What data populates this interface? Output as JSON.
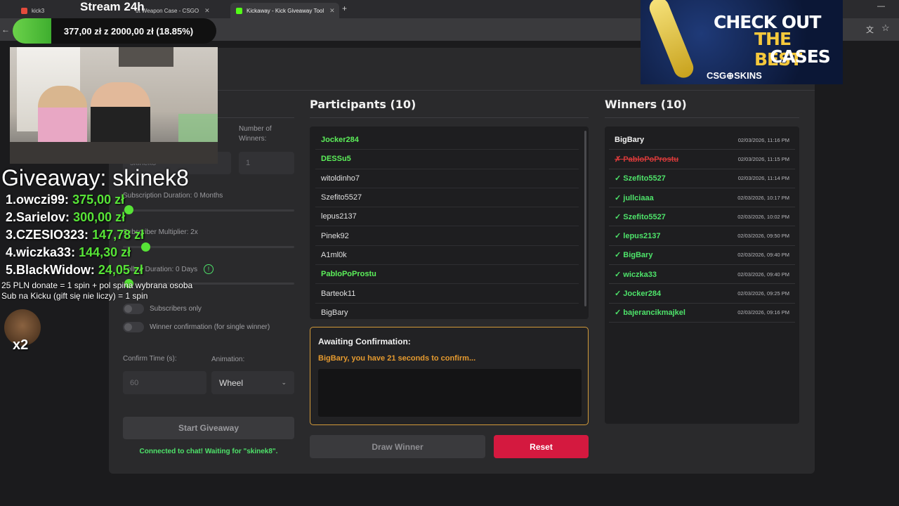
{
  "browser": {
    "tabs": [
      {
        "label": "kick3",
        "active": false
      },
      {
        "label": "ut Weapon Case - CSGO",
        "active": false
      },
      {
        "label": "Kickaway - Kick Giveaway Tool",
        "active": true
      }
    ],
    "new_tab": "+",
    "minimize": "—"
  },
  "stream_overlay": {
    "title": "Stream 24h",
    "goal_text": "377,00 zł z 2000,00 zł (18.85%)",
    "goal_progress": 0.1885,
    "giveaway_title": "Giveaway: skinek8",
    "leaderboard": [
      {
        "name": "1.owczi99:",
        "amount": "375,00 zł"
      },
      {
        "name": "2.Sarielov:",
        "amount": "300,00 zł"
      },
      {
        "name": "3.CZESIO323:",
        "amount": "147,78 zł"
      },
      {
        "name": "4.wiczka33:",
        "amount": "144,30 zł"
      },
      {
        "name": "5.BlackWidow:",
        "amount": "24,05 zł"
      }
    ],
    "rules": [
      "25 PLN donate = 1 spin + pol spina wybrana osoba",
      "Sub na Kicku (gift się nie liczy) = 1 spin"
    ],
    "emote_multiplier": "x2",
    "ad": {
      "line1": "CHECK OUT",
      "line2": "THE BEST",
      "line3": "CASES",
      "brand": "CSG⊕SKINS"
    }
  },
  "settings": {
    "winners_label": "Number of Winners:",
    "winners_value": "1",
    "keyword_value": "skinek8",
    "sub_duration": "Subscription Duration: 0 Months",
    "sub_multiplier": "Subscriber Multiplier: 2x",
    "follow_duration": "Follow Duration: 0 Days",
    "subscribers_only": "Subscribers only",
    "winner_confirmation": "Winner confirmation (for single winner)",
    "confirm_time_label": "Confirm Time (s):",
    "confirm_time_placeholder": "60",
    "animation_label": "Animation:",
    "animation_value": "Wheel",
    "start_button": "Start Giveaway",
    "status": "Connected to chat! Waiting for \"skinek8\"."
  },
  "participants": {
    "title": "Participants (10)",
    "items": [
      {
        "name": "Jocker284",
        "subscriber": true
      },
      {
        "name": "DESSu5",
        "subscriber": true
      },
      {
        "name": "witoldinho7",
        "subscriber": false
      },
      {
        "name": "Szefito5527",
        "subscriber": false
      },
      {
        "name": "lepus2137",
        "subscriber": false
      },
      {
        "name": "Pinek92",
        "subscriber": false
      },
      {
        "name": "A1ml0k",
        "subscriber": false
      },
      {
        "name": "PabloPoProstu",
        "subscriber": true
      },
      {
        "name": "Barteok11",
        "subscriber": false
      },
      {
        "name": "BigBary",
        "subscriber": false
      }
    ]
  },
  "confirmation": {
    "title": "Awaiting Confirmation:",
    "message": "BigBary, you have 21 seconds to confirm..."
  },
  "actions": {
    "draw": "Draw Winner",
    "reset": "Reset"
  },
  "winners": {
    "title": "Winners (10)",
    "items": [
      {
        "name": "BigBary",
        "time": "02/03/2026, 11:16 PM",
        "state": "first"
      },
      {
        "name": "✗ PabloPoProstu",
        "time": "02/03/2026, 11:15 PM",
        "state": "bad"
      },
      {
        "name": "✓ Szefito5527",
        "time": "02/03/2026, 11:14 PM",
        "state": "ok"
      },
      {
        "name": "✓ jullciaaa",
        "time": "02/03/2026, 10:17 PM",
        "state": "ok"
      },
      {
        "name": "✓ Szefito5527",
        "time": "02/03/2026, 10:02 PM",
        "state": "ok"
      },
      {
        "name": "✓ lepus2137",
        "time": "02/03/2026, 09:50 PM",
        "state": "ok"
      },
      {
        "name": "✓ BigBary",
        "time": "02/03/2026, 09:40 PM",
        "state": "ok"
      },
      {
        "name": "✓ wiczka33",
        "time": "02/03/2026, 09:40 PM",
        "state": "ok"
      },
      {
        "name": "✓ Jocker284",
        "time": "02/03/2026, 09:25 PM",
        "state": "ok"
      },
      {
        "name": "✓ bajerancikmajkel",
        "time": "02/03/2026, 09:16 PM",
        "state": "ok"
      }
    ]
  },
  "colors": {
    "accent_green": "#4ee36a",
    "reset_red": "#d4193f",
    "confirm_border": "#d29a3a"
  }
}
